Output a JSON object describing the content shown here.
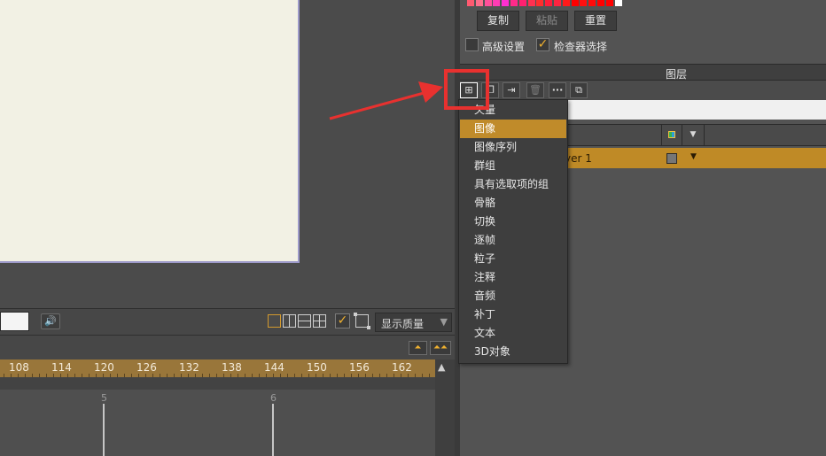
{
  "colors": {
    "accent": "#c08b2a",
    "annotation_red": "#e8312f",
    "canvas_bg": "#f2f1e4",
    "canvas_border": "#9d9ac9"
  },
  "swatches": [
    "#ff5a70",
    "#ff6e8c",
    "#ff4f9a",
    "#ff3cb4",
    "#ff2fd0",
    "#ff2a8a",
    "#ff2070",
    "#ff3050",
    "#ff2d2d",
    "#ff1d3a",
    "#ff2440",
    "#ff1a1a",
    "#ff0000",
    "#ff1010",
    "#ff0a0a",
    "#ff0000",
    "#ff0000",
    "#ffffff"
  ],
  "icons": {
    "speaker": "speaker-icon",
    "quality_dropdown": "triangle-down-icon"
  },
  "swatch_actions": {
    "copy": "复制",
    "paste": "粘贴",
    "reset": "重置"
  },
  "options": {
    "advanced_label": "高级设置",
    "inspector_label": "检查器选择",
    "advanced_checked": false,
    "inspector_checked": true
  },
  "view_bar": {
    "quality_label": "显示质量"
  },
  "timeline": {
    "ruler_labels": [
      "108",
      "114",
      "120",
      "126",
      "132",
      "138",
      "144",
      "150",
      "156",
      "162"
    ],
    "frame_markers": [
      "5",
      "6"
    ]
  },
  "layers_panel": {
    "title": "图层",
    "layer_name": "yer 1"
  },
  "layer_menu": {
    "items": [
      {
        "label": "矢量",
        "selected": false
      },
      {
        "label": "图像",
        "selected": true
      },
      {
        "label": "图像序列",
        "selected": false
      },
      {
        "label": "群组",
        "selected": false
      },
      {
        "label": "具有选取项的组",
        "selected": false
      },
      {
        "label": "骨骼",
        "selected": false
      },
      {
        "label": "切换",
        "selected": false
      },
      {
        "label": "逐帧",
        "selected": false
      },
      {
        "label": "粒子",
        "selected": false
      },
      {
        "label": "注释",
        "selected": false
      },
      {
        "label": "音频",
        "selected": false
      },
      {
        "label": "补丁",
        "selected": false
      },
      {
        "label": "文本",
        "selected": false
      },
      {
        "label": "3D对象",
        "selected": false
      }
    ]
  }
}
